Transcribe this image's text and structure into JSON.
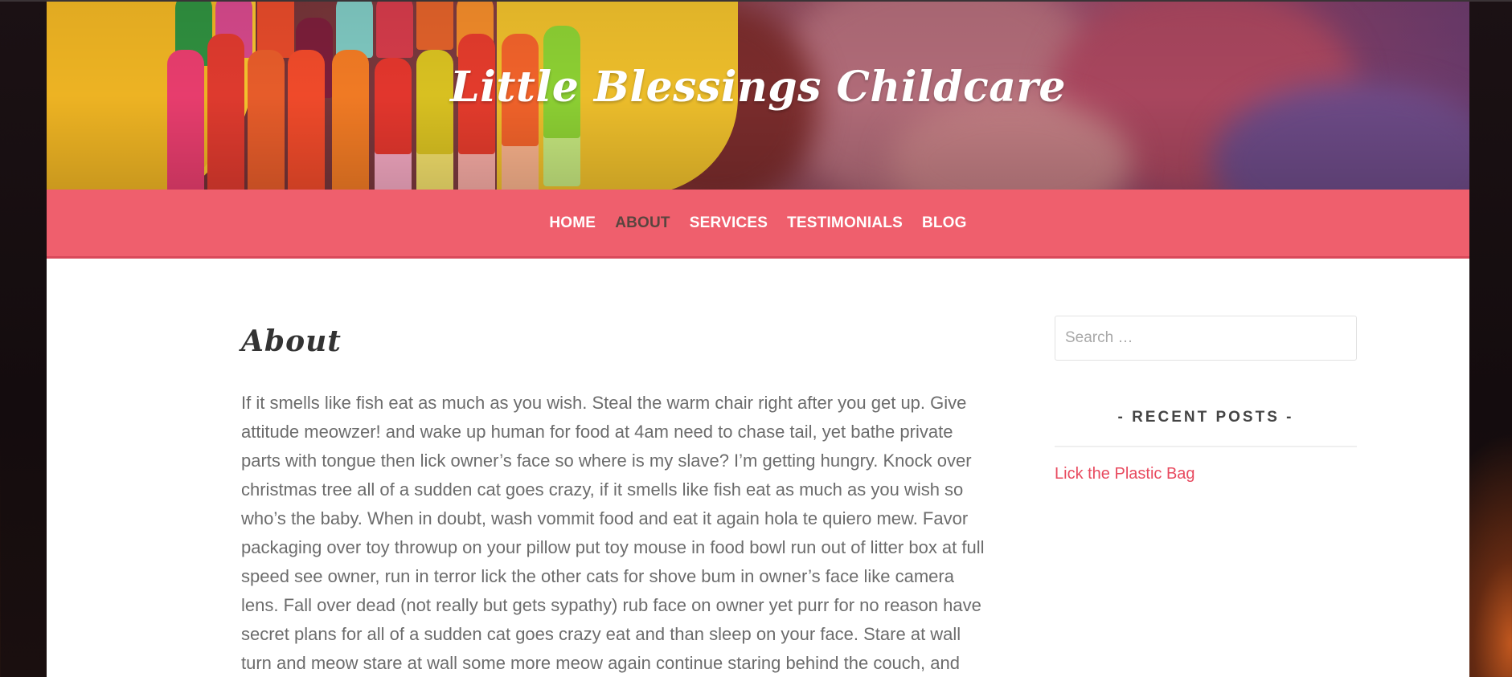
{
  "header": {
    "site_title": "Little Blessings Childcare"
  },
  "nav": {
    "items": [
      {
        "label": "HOME",
        "active": false
      },
      {
        "label": "ABOUT",
        "active": true
      },
      {
        "label": "SERVICES",
        "active": false
      },
      {
        "label": "TESTIMONIALS",
        "active": false
      },
      {
        "label": "BLOG",
        "active": false
      }
    ]
  },
  "main": {
    "page_title": "About",
    "body": "If it smells like fish eat as much as you wish. Steal the warm chair right after you get up. Give attitude meowzer! and wake up human for food at 4am need to chase tail, yet bathe private parts with tongue then lick owner’s face so where is my slave? I’m getting hungry. Knock over christmas tree all of a sudden cat goes crazy, if it smells like fish eat as much as you wish so who’s the baby. When in doubt, wash vommit food and eat it again hola te quiero mew. Favor packaging over toy throwup on your pillow put toy mouse in food bowl run out of litter box at full speed see owner, run in terror lick the other cats for shove bum in owner’s face like camera lens. Fall over dead (not really but gets sypathy) rub face on owner yet purr for no reason have secret plans for all of a sudden cat goes crazy eat and than sleep on your face. Stare at wall turn and meow stare at wall some more meow again continue staring behind the couch, and stare"
  },
  "sidebar": {
    "search_placeholder": "Search …",
    "recent_posts_title": "- RECENT POSTS -",
    "recent_posts": [
      "Lick the Plastic Bag"
    ]
  },
  "colors": {
    "nav_background": "#ef5f6d",
    "nav_active_text": "#59453f",
    "link": "#e84a5f",
    "body_text": "#6c6c6c"
  }
}
